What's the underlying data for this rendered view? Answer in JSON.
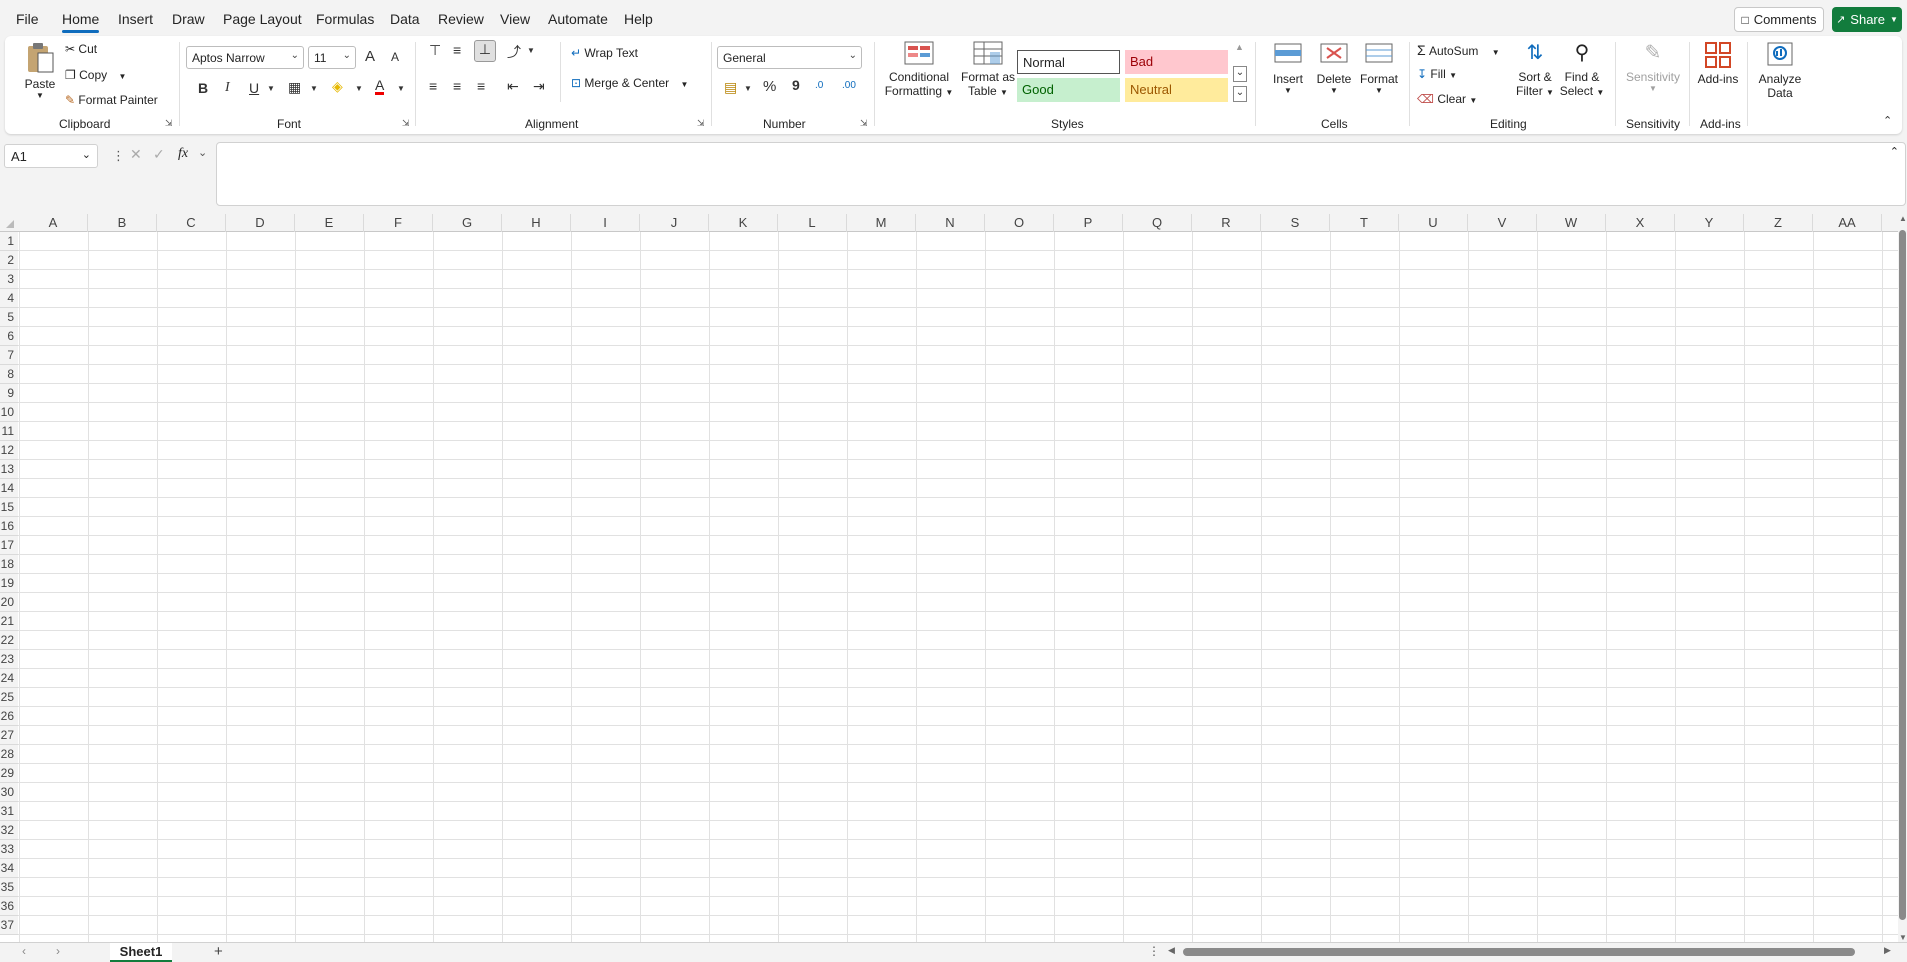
{
  "menu": {
    "tabs": [
      "File",
      "Home",
      "Insert",
      "Draw",
      "Page Layout",
      "Formulas",
      "Data",
      "Review",
      "View",
      "Automate",
      "Help"
    ],
    "comments_label": "Comments",
    "share_label": "Share"
  },
  "ribbon": {
    "clipboard": {
      "paste": "Paste",
      "cut": "Cut",
      "copy": "Copy",
      "format_painter": "Format Painter",
      "label": "Clipboard"
    },
    "font": {
      "family": "Aptos Narrow",
      "size": "11",
      "bold": "B",
      "italic": "I",
      "underline": "U",
      "grow": "A",
      "shrink": "A",
      "font_color": "A",
      "label": "Font"
    },
    "alignment": {
      "wrap_text": "Wrap Text",
      "merge_center": "Merge & Center",
      "label": "Alignment"
    },
    "number": {
      "format": "General",
      "percent": "%",
      "comma": "9",
      "inc_decimal": ".0",
      "dec_decimal": ".00",
      "label": "Number"
    },
    "styles": {
      "conditional": "Conditional",
      "conditional2": "Formatting",
      "format_as": "Format as",
      "format_as2": "Table",
      "normal": "Normal",
      "bad": "Bad",
      "good": "Good",
      "neutral": "Neutral",
      "label": "Styles"
    },
    "cells": {
      "insert": "Insert",
      "delete": "Delete",
      "format": "Format",
      "label": "Cells"
    },
    "editing": {
      "autosum": "AutoSum",
      "fill": "Fill",
      "clear": "Clear",
      "sort": "Sort &",
      "sort2": "Filter",
      "find": "Find &",
      "find2": "Select",
      "label": "Editing"
    },
    "sensitivity": {
      "button": "Sensitivity",
      "label": "Sensitivity"
    },
    "addins": {
      "button": "Add-ins",
      "label": "Add-ins"
    },
    "analyze": {
      "button": "Analyze",
      "button2": "Data"
    }
  },
  "formula_bar": {
    "name_box": "A1",
    "fx": "fx",
    "formula": ""
  },
  "grid": {
    "columns": [
      "A",
      "B",
      "C",
      "D",
      "E",
      "F",
      "G",
      "H",
      "I",
      "J",
      "K",
      "L",
      "M",
      "N",
      "O",
      "P",
      "Q",
      "R",
      "S",
      "T",
      "U",
      "V",
      "W",
      "X",
      "Y",
      "Z",
      "AA"
    ],
    "rows": [
      "1",
      "2",
      "3",
      "4",
      "5",
      "6",
      "7",
      "8",
      "9",
      "10",
      "11",
      "12",
      "13",
      "14",
      "15",
      "16",
      "17",
      "18",
      "19",
      "20",
      "21",
      "22",
      "23",
      "24",
      "25",
      "26",
      "27",
      "28",
      "29",
      "30",
      "31",
      "32",
      "33",
      "34",
      "35",
      "36",
      "37"
    ]
  },
  "sheets": {
    "tabs": [
      "Sheet1"
    ],
    "add": "+"
  },
  "colors": {
    "accent": "#0f6cbd",
    "share": "#127c3d",
    "bad_bg": "#ffc7ce",
    "bad_fg": "#9c0006",
    "good_bg": "#c6efce",
    "good_fg": "#006100",
    "neutral_bg": "#ffeb9c",
    "neutral_fg": "#9c5700"
  }
}
